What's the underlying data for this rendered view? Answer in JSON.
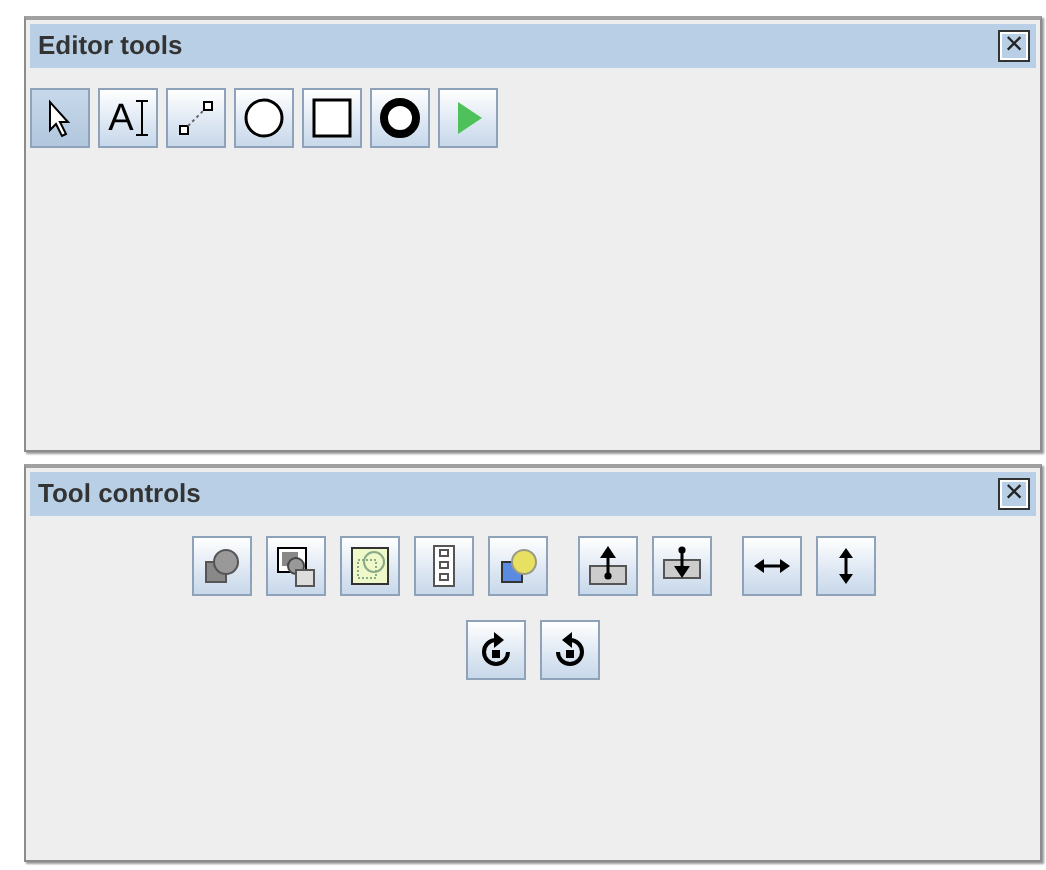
{
  "panels": [
    {
      "title": "Editor tools",
      "close_glyph": "×",
      "tools": [
        {
          "kind": "pointer",
          "selected": true
        },
        {
          "kind": "text",
          "label": "A",
          "selected": false
        },
        {
          "kind": "line",
          "selected": false
        },
        {
          "kind": "circle",
          "selected": false
        },
        {
          "kind": "square",
          "selected": false
        },
        {
          "kind": "ring",
          "selected": false
        },
        {
          "kind": "play",
          "selected": false
        }
      ]
    },
    {
      "title": "Tool controls",
      "close_glyph": "×",
      "rows": [
        [
          {
            "kind": "shapes-gray"
          },
          {
            "kind": "layers"
          },
          {
            "kind": "shapes-green"
          },
          {
            "kind": "chain"
          },
          {
            "kind": "shapes-blue"
          },
          {
            "kind": "up-bar",
            "gap_before": true
          },
          {
            "kind": "down-bar"
          },
          {
            "kind": "h-arrow",
            "gap_before": true
          },
          {
            "kind": "v-arrow"
          }
        ],
        [
          {
            "kind": "rotate-right"
          },
          {
            "kind": "rotate-left"
          }
        ]
      ]
    }
  ]
}
